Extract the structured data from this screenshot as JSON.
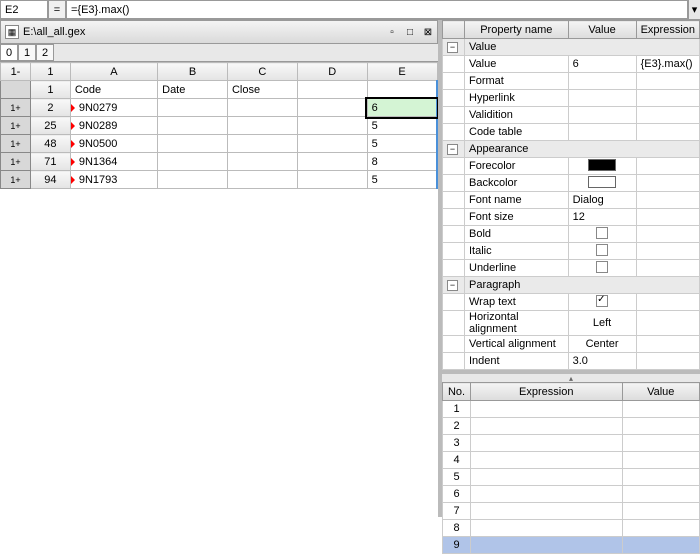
{
  "formula": {
    "cell_ref": "E2",
    "eq": "=",
    "expr": "={E3}.max()"
  },
  "document": {
    "title": "E:\\all_all.gex"
  },
  "sheet_tabs": [
    "0",
    "1",
    "2"
  ],
  "grid": {
    "top_left": "1-",
    "cols": [
      "1",
      "A",
      "B",
      "C",
      "D",
      "E"
    ],
    "header_row": {
      "num": "1",
      "A": "Code",
      "B": "Date",
      "C": "Close",
      "D": "",
      "E": ""
    },
    "rows": [
      {
        "btn": "1+",
        "num": "2",
        "A": "9N0279",
        "B": "",
        "C": "",
        "D": "",
        "E": "6",
        "selected": true
      },
      {
        "btn": "1+",
        "num": "25",
        "A": "9N0289",
        "B": "",
        "C": "",
        "D": "",
        "E": "5"
      },
      {
        "btn": "1+",
        "num": "48",
        "A": "9N0500",
        "B": "",
        "C": "",
        "D": "",
        "E": "5"
      },
      {
        "btn": "1+",
        "num": "71",
        "A": "9N1364",
        "B": "",
        "C": "",
        "D": "",
        "E": "8"
      },
      {
        "btn": "1+",
        "num": "94",
        "A": "9N1793",
        "B": "",
        "C": "",
        "D": "",
        "E": "5"
      }
    ]
  },
  "props": {
    "headers": [
      "Property name",
      "Value",
      "Expression"
    ],
    "sections": {
      "value": {
        "title": "Value",
        "rows": [
          {
            "label": "Value",
            "value": "6",
            "expr": "{E3}.max()"
          },
          {
            "label": "Format",
            "value": "",
            "expr": ""
          },
          {
            "label": "Hyperlink",
            "value": "",
            "expr": ""
          },
          {
            "label": "Validition",
            "value": "",
            "expr": ""
          },
          {
            "label": "Code table",
            "value": "",
            "expr": ""
          }
        ]
      },
      "appearance": {
        "title": "Appearance",
        "rows": [
          {
            "label": "Forecolor",
            "value_swatch": "black"
          },
          {
            "label": "Backcolor",
            "value_swatch": "white"
          },
          {
            "label": "Font name",
            "value": "Dialog"
          },
          {
            "label": "Font size",
            "value": "12"
          },
          {
            "label": "Bold",
            "checkbox": false
          },
          {
            "label": "Italic",
            "checkbox": false
          },
          {
            "label": "Underline",
            "checkbox": false
          }
        ]
      },
      "paragraph": {
        "title": "Paragraph",
        "rows": [
          {
            "label": "Wrap text",
            "checkbox": true
          },
          {
            "label": "Horizontal alignment",
            "value": "Left"
          },
          {
            "label": "Vertical alignment",
            "value": "Center"
          },
          {
            "label": "Indent",
            "value": "3.0"
          }
        ]
      }
    }
  },
  "watch": {
    "headers": [
      "No.",
      "Expression",
      "Value"
    ],
    "rows": [
      "1",
      "2",
      "3",
      "4",
      "5",
      "6",
      "7",
      "8",
      "9"
    ],
    "selected": "9"
  }
}
